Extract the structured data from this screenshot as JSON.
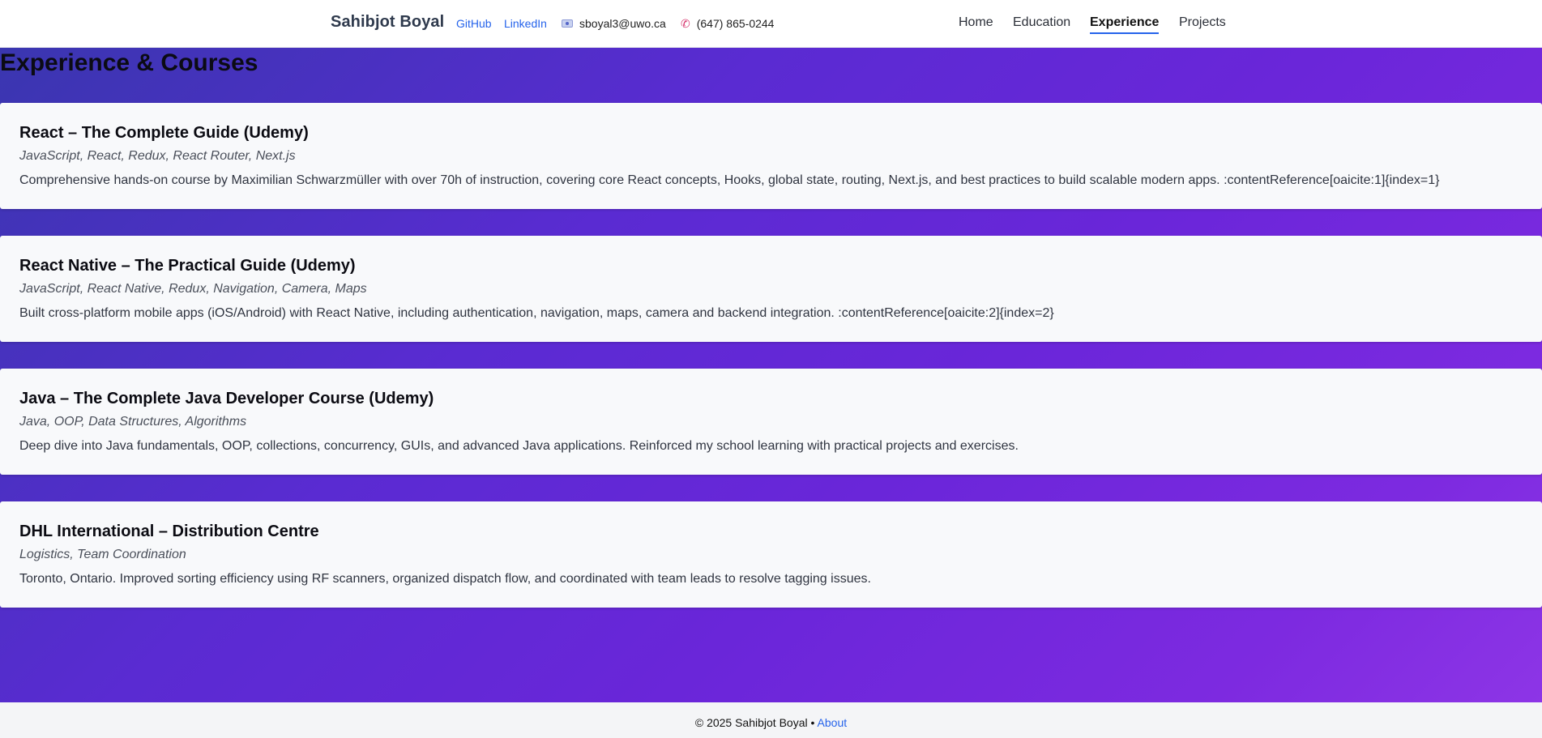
{
  "header": {
    "brand": "Sahibjot Boyal",
    "github_label": "GitHub",
    "linkedin_label": "LinkedIn",
    "email": "sboyal3@uwo.ca",
    "phone": "(647) 865-0244",
    "nav": [
      {
        "label": "Home"
      },
      {
        "label": "Education"
      },
      {
        "label": "Experience",
        "active": true
      },
      {
        "label": "Projects"
      }
    ]
  },
  "main": {
    "title": "Experience & Courses",
    "cards": [
      {
        "title": "React – The Complete Guide (Udemy)",
        "tags": "JavaScript, React, Redux, React Router, Next.js",
        "description": "Comprehensive hands-on course by Maximilian Schwarzmüller with over 70h of instruction, covering core React concepts, Hooks, global state, routing, Next.js, and best practices to build scalable modern apps. :contentReference[oaicite:1]{index=1}"
      },
      {
        "title": "React Native – The Practical Guide (Udemy)",
        "tags": "JavaScript, React Native, Redux, Navigation, Camera, Maps",
        "description": "Built cross-platform mobile apps (iOS/Android) with React Native, including authentication, navigation, maps, camera and backend integration. :contentReference[oaicite:2]{index=2}"
      },
      {
        "title": "Java – The Complete Java Developer Course (Udemy)",
        "tags": "Java, OOP, Data Structures, Algorithms",
        "description": "Deep dive into Java fundamentals, OOP, collections, concurrency, GUIs, and advanced Java applications. Reinforced my school learning with practical projects and exercises."
      },
      {
        "title": "DHL International – Distribution Centre",
        "tags": "Logistics, Team Coordination",
        "description": "Toronto, Ontario. Improved sorting efficiency using RF scanners, organized dispatch flow, and coordinated with team leads to resolve tagging issues."
      }
    ]
  },
  "footer": {
    "text": "© 2025 Sahibjot Boyal •",
    "about_label": "About"
  },
  "icons": {
    "email": "email-icon",
    "phone": "phone-icon"
  },
  "colors": {
    "link": "#2563eb",
    "gradient_start": "#3a36b0",
    "gradient_end": "#8d35e6",
    "card_bg": "#f8f9fb"
  }
}
